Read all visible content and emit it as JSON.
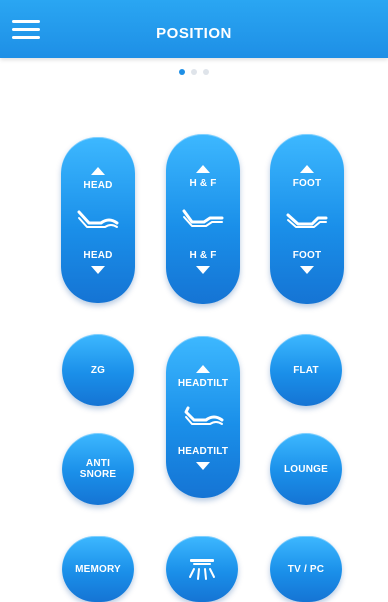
{
  "header": {
    "title": "POSITION"
  },
  "pager": {
    "active": 0,
    "count": 3
  },
  "controls": {
    "head": {
      "up_label": "HEAD",
      "down_label": "HEAD",
      "icon": "bed-head-raise-icon"
    },
    "hf": {
      "up_label": "H & F",
      "down_label": "H & F",
      "icon": "bed-head-foot-icon"
    },
    "foot": {
      "up_label": "FOOT",
      "down_label": "FOOT",
      "icon": "bed-foot-raise-icon"
    },
    "headtilt": {
      "up_label": "HEADTILT",
      "down_label": "HEADTILT",
      "icon": "bed-headtilt-icon"
    },
    "zg": "ZG",
    "flat": "FLAT",
    "anti_snore_line1": "ANTI",
    "anti_snore_line2": "SNORE",
    "lounge": "LOUNGE",
    "memory": "MEMORY",
    "light": {
      "icon": "under-bed-light-icon"
    },
    "tvpc": "TV / PC"
  },
  "colors": {
    "accent": "#1e8fe6",
    "button": "#2a9ef0",
    "text": "#ffffff"
  }
}
